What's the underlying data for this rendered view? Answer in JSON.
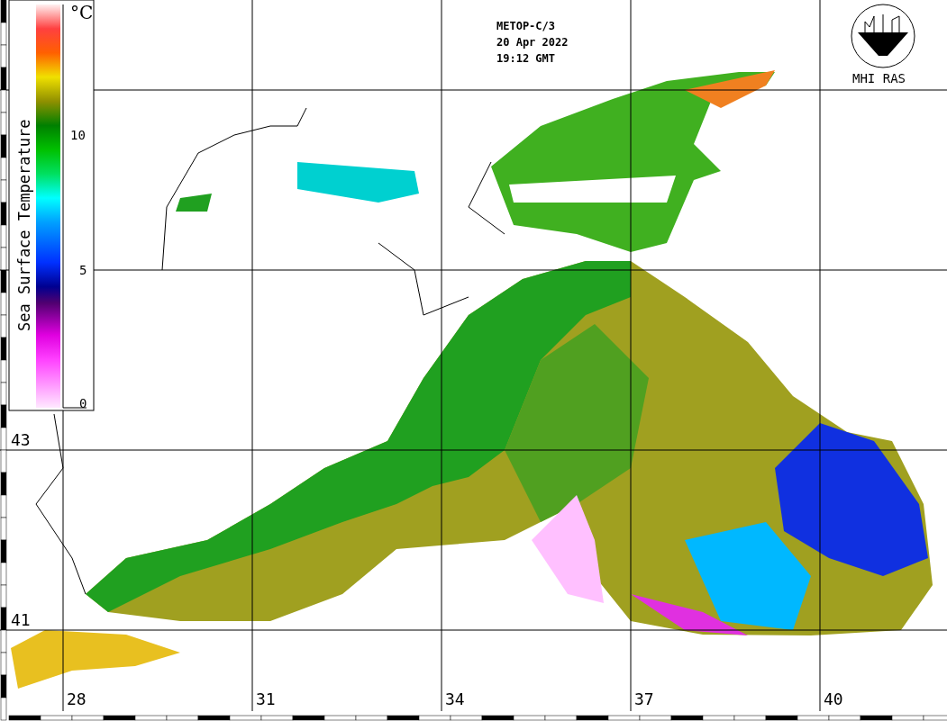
{
  "header": {
    "lines": [
      "METOP-C/3",
      "20 Apr 2022",
      "19:12 GMT"
    ]
  },
  "logo": {
    "label": "MHI RAS"
  },
  "color_scale": {
    "title": "Sea Surface Temperature",
    "unit": "°C",
    "ticks": [
      "10",
      "5",
      "0"
    ]
  },
  "latitude_labels": [
    "43",
    "41"
  ],
  "longitude_labels": [
    "28",
    "31",
    "34",
    "37",
    "40"
  ]
}
